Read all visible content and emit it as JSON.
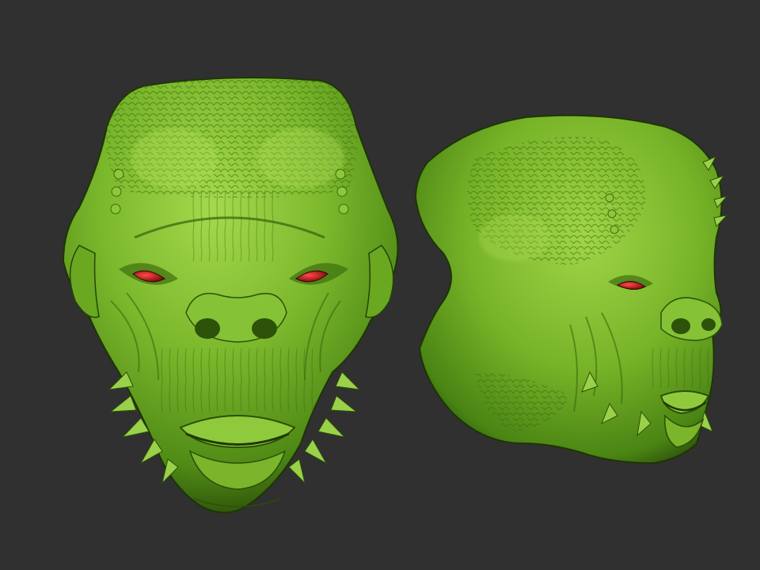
{
  "viewport": {
    "icon": "3d-sculpt-viewport-icon",
    "background_color": "#303030"
  },
  "sculpts": [
    {
      "view": "front",
      "icon": "reptilian-alien-head-front-icon",
      "skin_color": "#78b62a",
      "eye_color": "#cc1f1f"
    },
    {
      "view": "three-quarter",
      "icon": "reptilian-alien-head-three-quarter-icon",
      "skin_color": "#78b62a",
      "eye_color": "#cc1f1f"
    }
  ]
}
